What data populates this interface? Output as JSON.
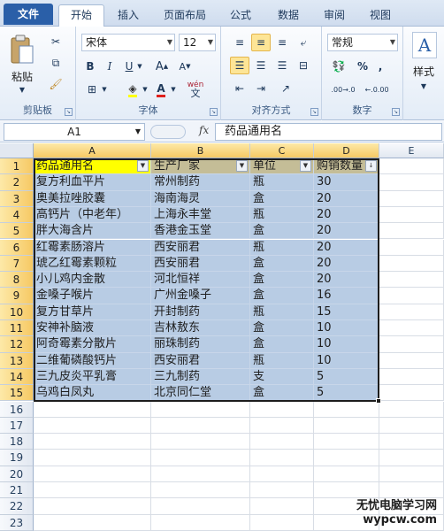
{
  "ribbon": {
    "tabs": [
      "文件",
      "开始",
      "插入",
      "页面布局",
      "公式",
      "数据",
      "审阅",
      "视图"
    ],
    "active_tab": "开始",
    "clipboard": {
      "paste_label": "粘贴",
      "group_label": "剪贴板"
    },
    "font": {
      "name": "宋体",
      "size": "12",
      "group_label": "字体",
      "bold": "B",
      "italic": "I",
      "underline": "U",
      "grow": "A",
      "shrink": "A",
      "color_a": "A",
      "wen": "wén"
    },
    "alignment": {
      "group_label": "对齐方式"
    },
    "number": {
      "format": "常规",
      "group_label": "数字",
      "percent": "%",
      "comma": ",",
      "inc_dec": ".00→.0",
      "dec_dec": "←.0.00"
    },
    "styles": {
      "label": "样式"
    }
  },
  "formula_bar": {
    "name_box": "A1",
    "fx": "fx",
    "value": "药品通用名"
  },
  "sheet": {
    "columns": [
      "A",
      "B",
      "C",
      "D",
      "E"
    ],
    "header_row": [
      "药品通用名",
      "生产厂家",
      "单位",
      "购销数量"
    ],
    "rows": [
      [
        "复方利血平片",
        "常州制药",
        "瓶",
        "30"
      ],
      [
        "奥美拉唑胶囊",
        "海南海灵",
        "盒",
        "20"
      ],
      [
        "高钙片（中老年）",
        "上海永丰堂",
        "瓶",
        "20"
      ],
      [
        "胖大海含片",
        "香港金玉堂",
        "盒",
        "20"
      ],
      [
        "红霉素肠溶片",
        "西安丽君",
        "瓶",
        "20"
      ],
      [
        "琥乙红霉素颗粒",
        "西安丽君",
        "盒",
        "20"
      ],
      [
        "小儿鸡内金散",
        "河北恒祥",
        "盒",
        "20"
      ],
      [
        "金嗓子喉片",
        "广州金嗓子",
        "盒",
        "16"
      ],
      [
        "复方甘草片",
        "开封制药",
        "瓶",
        "15"
      ],
      [
        "安神补脑液",
        "吉林敖东",
        "盒",
        "10"
      ],
      [
        "阿奇霉素分散片",
        "丽珠制药",
        "盒",
        "10"
      ],
      [
        "二维葡磷酸钙片",
        "西安丽君",
        "瓶",
        "10"
      ],
      [
        "三九皮炎平乳膏",
        "三九制药",
        "支",
        "5"
      ],
      [
        "乌鸡白凤丸",
        "北京同仁堂",
        "盒",
        "5"
      ]
    ],
    "row_numbers": [
      "1",
      "2",
      "3",
      "4",
      "5",
      "6",
      "7",
      "8",
      "9",
      "10",
      "11",
      "12",
      "13",
      "14",
      "15",
      "16",
      "17",
      "18",
      "19",
      "20",
      "21",
      "22",
      "23"
    ]
  },
  "watermark": {
    "line1": "无忧电脑学习网",
    "line2": "wypcw.com"
  },
  "colors": {
    "accent": "#2a5fa8",
    "header_fill": "#ffff00",
    "data_fill": "#b8cce4"
  }
}
